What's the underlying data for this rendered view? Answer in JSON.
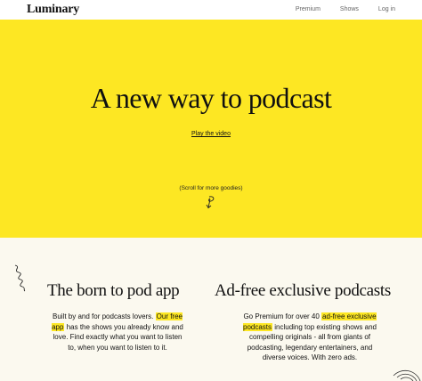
{
  "nav": {
    "logo": "Luminary",
    "links": [
      "Premium",
      "Shows",
      "Log in"
    ]
  },
  "hero": {
    "headline": "A new way to podcast",
    "play_link": "Play the video",
    "scroll_hint": "(Scroll for more goodies)"
  },
  "features": [
    {
      "title": "The born to pod app",
      "text_before": "Built by and for podcasts lovers. ",
      "highlight": "Our free app",
      "text_after": " has the shows you already know and love. Find exactly what you want to listen to, when you want to listen to it."
    },
    {
      "title": "Ad-free exclusive podcasts",
      "text_before": "Go Premium for over 40 ",
      "highlight": "ad-free exclusive podcasts",
      "text_after": " including top existing shows and compelling originals - all from giants of podcasting, legendary entertainers, and diverse voices. With zero ads."
    }
  ],
  "colors": {
    "accent_yellow": "#fde723",
    "page_background": "#fbf9ef",
    "text": "#111111"
  }
}
